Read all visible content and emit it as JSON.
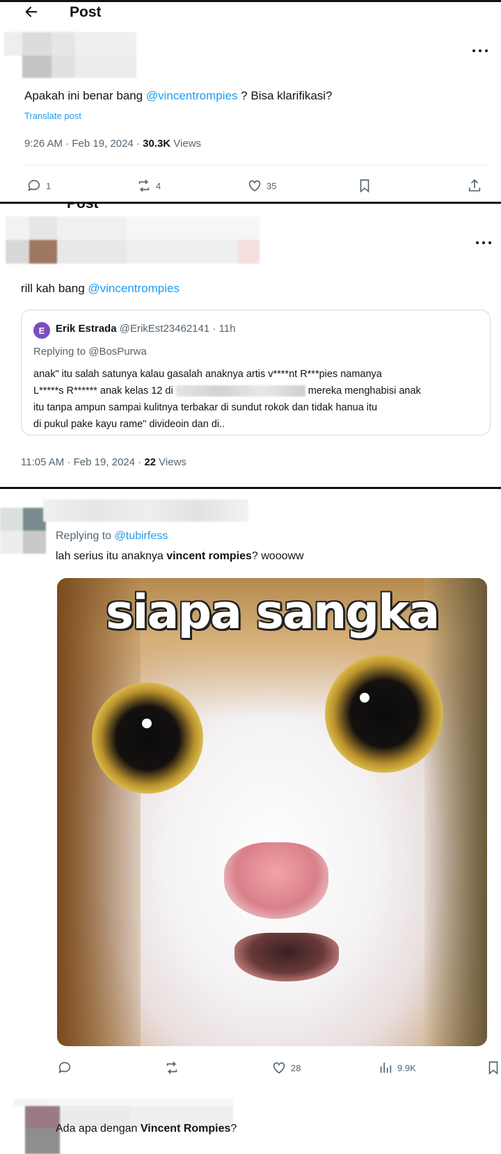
{
  "panel1": {
    "title": "Post",
    "text_before": "Apakah ini benar bang ",
    "mention": "@vincentrompies",
    "text_after": " ? Bisa klarifikasi?",
    "translate": "Translate post",
    "time": "9:26 AM · Feb 19, 2024 · ",
    "views_count": "30.3K",
    "views_label": " Views",
    "actions": {
      "replies": "1",
      "reposts": "4",
      "likes": "35"
    }
  },
  "panel2": {
    "cut_title": "Post",
    "text_before": "rill kah bang ",
    "mention": "@vincentrompies",
    "quote": {
      "avatar_letter": "E",
      "name": "Erik Estrada",
      "handle": "@ErikEst23462141 · 11h",
      "replying": "Replying to @BosPurwa",
      "body_line1_a": "anak\" itu salah satunya kalau gasalah anaknya artis v****nt R***pies namanya",
      "body_line2_a": "L*****s R****** anak kelas 12 di",
      "body_line2_b": "mereka menghabisi anak",
      "body_line3": "itu tanpa ampun sampai kulitnya terbakar di sundut rokok dan tidak hanua itu",
      "body_line4": "di pukul pake kayu rame\" divideoin dan di.."
    },
    "time": "11:05 AM · Feb 19, 2024 · ",
    "views_count": "22",
    "views_label": " Views"
  },
  "panel3": {
    "replying_prefix": "Replying to ",
    "replying_handle": "@tubirfess",
    "text_before": "lah serius itu anaknya ",
    "text_bold": "vincent rompies",
    "text_after": "? woooww",
    "meme_caption": "siapa sangka",
    "actions": {
      "likes": "28",
      "views": "9.9K"
    }
  },
  "panel4": {
    "text_before": "Ada apa dengan ",
    "text_bold": "Vincent Rompies",
    "text_after": "?"
  },
  "colors": {
    "mention": "#1d9bf0",
    "muted": "#536471",
    "border": "#111111"
  },
  "icons": [
    "back-arrow-icon",
    "more-icon",
    "reply-icon",
    "repost-icon",
    "like-icon",
    "bookmark-icon",
    "share-icon",
    "views-icon"
  ]
}
